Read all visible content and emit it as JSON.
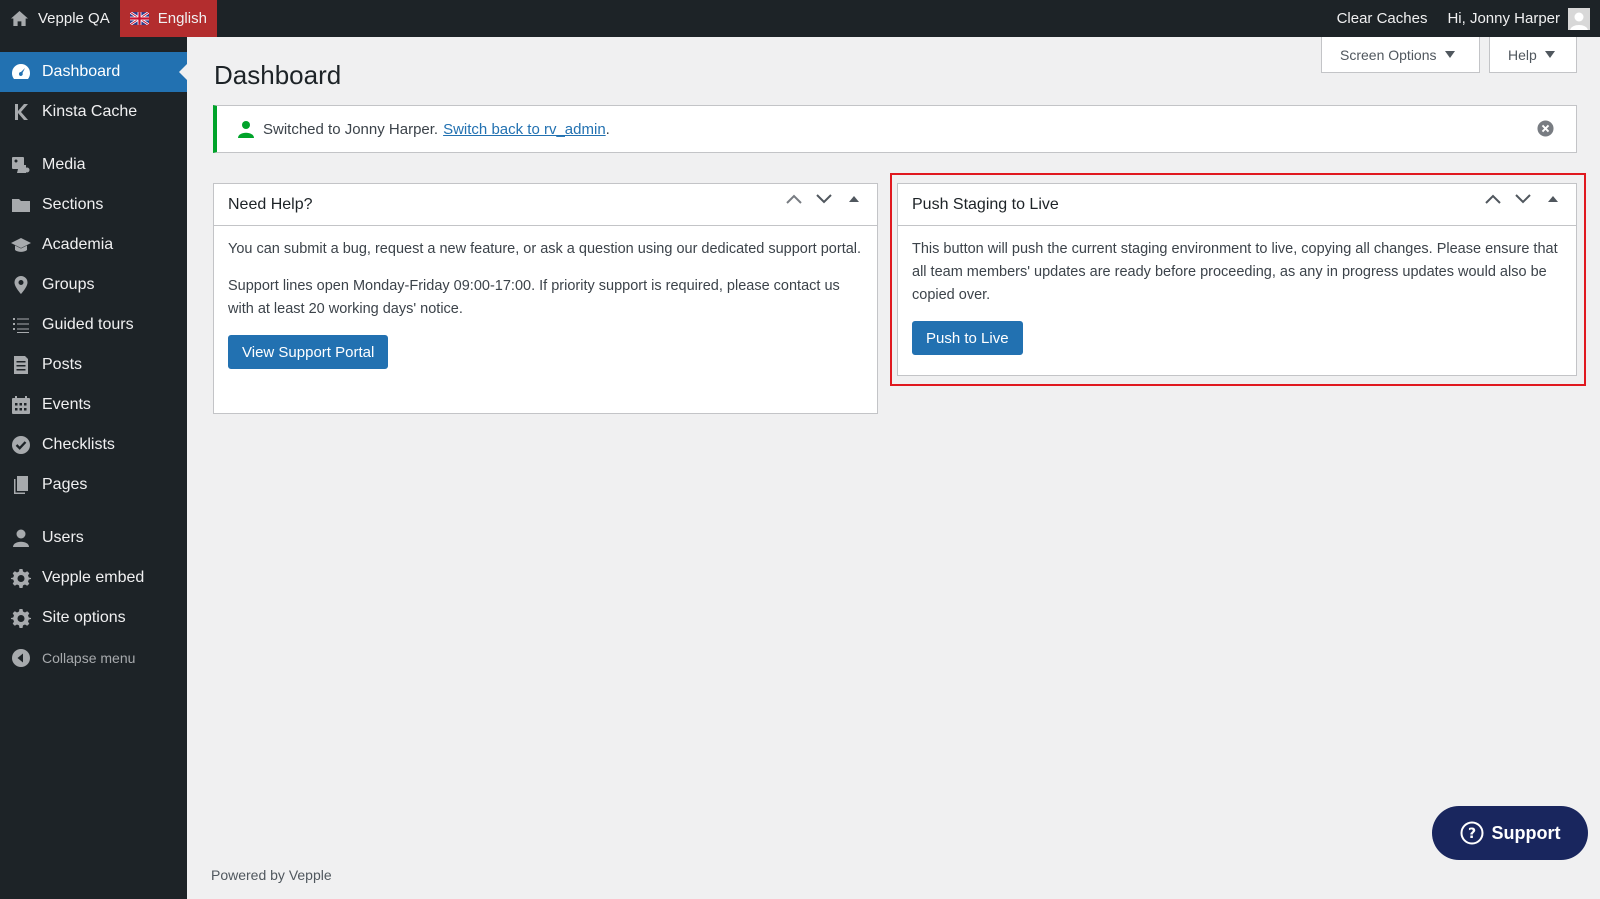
{
  "adminbar": {
    "site_name": "Vepple QA",
    "language": "English",
    "clear_caches": "Clear Caches",
    "greeting": "Hi, Jonny Harper"
  },
  "sidebar": {
    "items": [
      {
        "label": "Dashboard",
        "icon": "dashboard-icon",
        "active": true
      },
      {
        "label": "Kinsta Cache",
        "icon": "kinsta-icon"
      },
      {
        "label": "Media",
        "icon": "media-icon"
      },
      {
        "label": "Sections",
        "icon": "folder-icon"
      },
      {
        "label": "Academia",
        "icon": "graduation-cap-icon"
      },
      {
        "label": "Groups",
        "icon": "location-pin-icon"
      },
      {
        "label": "Guided tours",
        "icon": "list-icon"
      },
      {
        "label": "Posts",
        "icon": "posts-icon"
      },
      {
        "label": "Events",
        "icon": "calendar-icon"
      },
      {
        "label": "Checklists",
        "icon": "check-circle-icon"
      },
      {
        "label": "Pages",
        "icon": "pages-icon"
      },
      {
        "label": "Users",
        "icon": "user-icon"
      },
      {
        "label": "Vepple embed",
        "icon": "gear-icon"
      },
      {
        "label": "Site options",
        "icon": "gear-icon"
      }
    ],
    "collapse_label": "Collapse menu"
  },
  "screen_options": {
    "screen_options_label": "Screen Options",
    "help_label": "Help"
  },
  "page": {
    "title": "Dashboard"
  },
  "notice": {
    "text": "Switched to Jonny Harper.",
    "link_text": "Switch back to rv_admin",
    "trailing": "."
  },
  "need_help": {
    "title": "Need Help?",
    "para1": "You can submit a bug, request a new feature, or ask a question using our dedicated support portal.",
    "para2": "Support lines open Monday-Friday 09:00-17:00. If priority support is required, please contact us with at least 20 working days' notice.",
    "button": "View Support Portal"
  },
  "push_staging": {
    "title": "Push Staging to Live",
    "para": "This button will push the current staging environment to live, copying all changes. Please ensure that all team members' updates are ready before proceeding, as any in progress updates would also be copied over.",
    "button": "Push to Live"
  },
  "footer": {
    "text": "Powered by Vepple"
  },
  "support": {
    "label": "Support"
  },
  "colors": {
    "accent": "#2271b1",
    "adminbar": "#1d2327",
    "language_bg": "#b32d2e",
    "notice_border": "#00a32a",
    "highlight": "#e0181f",
    "support_bg": "#19265e"
  }
}
